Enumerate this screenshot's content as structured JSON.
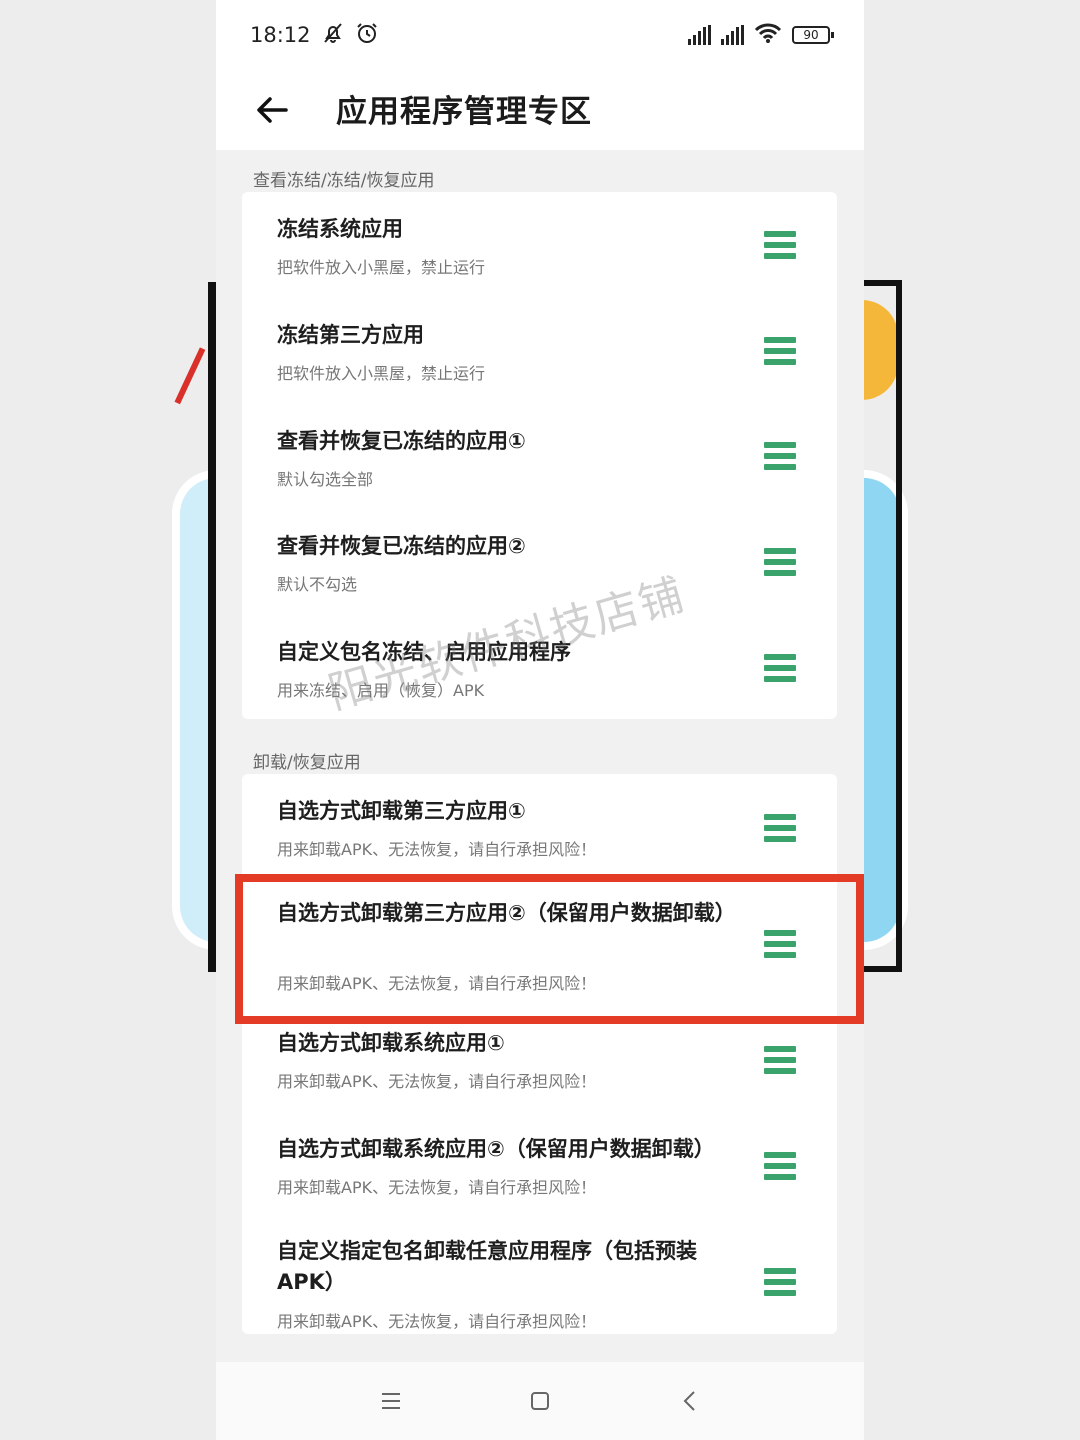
{
  "status_bar": {
    "time": "18:12",
    "icons_left": [
      "bell-off-icon",
      "alarm-icon"
    ],
    "icons_right": [
      "hd-signal-icon",
      "hd-signal-icon",
      "wifi-icon",
      "battery-icon"
    ],
    "battery_level": "90"
  },
  "header": {
    "back_icon": "arrow-left-icon",
    "title": "应用程序管理专区"
  },
  "sections": [
    {
      "title": "查看冻结/冻结/恢复应用",
      "items": [
        {
          "title": "冻结系统应用",
          "subtitle": "把软件放入小黑屋，禁止运行"
        },
        {
          "title": "冻结第三方应用",
          "subtitle": "把软件放入小黑屋，禁止运行"
        },
        {
          "title": "查看并恢复已冻结的应用①",
          "subtitle": "默认勾选全部"
        },
        {
          "title": "查看并恢复已冻结的应用②",
          "subtitle": "默认不勾选"
        },
        {
          "title": "自定义包名冻结、启用应用程序",
          "subtitle": "用来冻结、启用（恢复）APK"
        }
      ]
    },
    {
      "title": "卸载/恢复应用",
      "items": [
        {
          "title": "自选方式卸载第三方应用①",
          "subtitle": "用来卸载APK、无法恢复，请自行承担风险！"
        },
        {
          "title": "自选方式卸载第三方应用②（保留用户数据卸载）",
          "subtitle": "用来卸载APK、无法恢复，请自行承担风险！"
        },
        {
          "title": "自选方式卸载系统应用①",
          "subtitle": "用来卸载APK、无法恢复，请自行承担风险！"
        },
        {
          "title": "自选方式卸载系统应用②（保留用户数据卸载）",
          "subtitle": "用来卸载APK、无法恢复，请自行承担风险！"
        },
        {
          "title": "自定义指定包名卸载任意应用程序（包括预装APK）",
          "subtitle": "用来卸载APK、无法恢复，请自行承担风险！"
        }
      ]
    }
  ],
  "item_icon": "menu-icon",
  "highlight_color": "#e33b26",
  "accent_color": "#3aa36c",
  "watermark": "阳光软件科技店铺",
  "nav_bar": {
    "icons": [
      "menu-lines-icon",
      "home-square-icon",
      "back-chevron-icon"
    ]
  }
}
